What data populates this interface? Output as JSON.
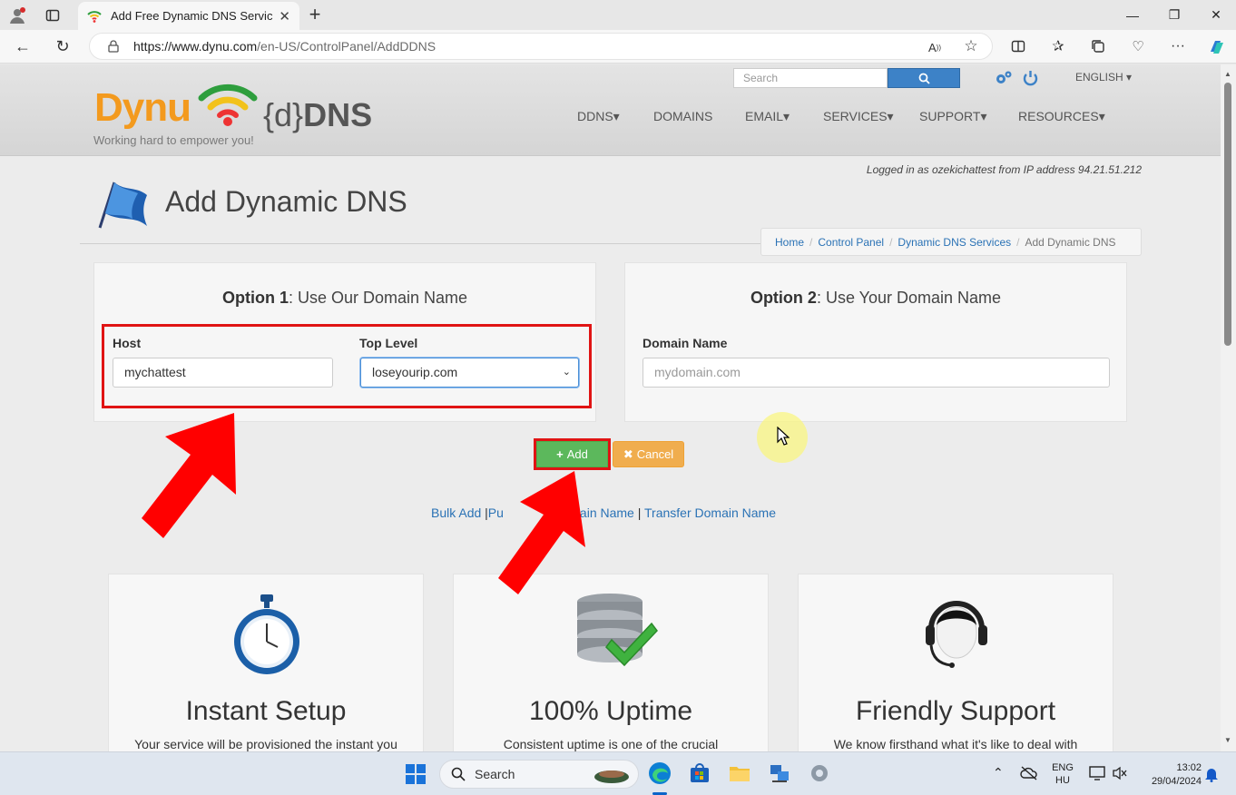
{
  "browser": {
    "tab_title": "Add Free Dynamic DNS Service |",
    "url_host": "https://www.dynu.com",
    "url_path": "/en-US/ControlPanel/AddDDNS"
  },
  "header": {
    "search_placeholder": "Search",
    "language": "ENGLISH",
    "logo_text": "Dynu",
    "logo_brace": "{d}",
    "logo_dns": "DNS",
    "tagline": "Working hard to empower you!",
    "nav": [
      "DDNS",
      "DOMAINS",
      "EMAIL",
      "SERVICES",
      "SUPPORT",
      "RESOURCES"
    ]
  },
  "page": {
    "logged_in": "Logged in as ozekichattest from IP address 94.21.51.212",
    "title": "Add Dynamic DNS",
    "breadcrumb": [
      "Home",
      "Control Panel",
      "Dynamic DNS Services",
      "Add Dynamic DNS"
    ]
  },
  "option1": {
    "title_bold": "Option 1",
    "title_rest": ": Use Our Domain Name",
    "host_label": "Host",
    "host_value": "mychattest",
    "top_level_label": "Top Level",
    "top_level_value": "loseyourip.com"
  },
  "option2": {
    "title_bold": "Option 2",
    "title_rest": ": Use Your Domain Name",
    "domain_label": "Domain Name",
    "domain_placeholder": "mydomain.com"
  },
  "actions": {
    "add": "Add",
    "cancel": "Cancel"
  },
  "links": {
    "bulk_add": "Bulk Add",
    "sep1": "|",
    "purchase_visible_start": "Pu",
    "purchase_visible_end": "ain Name",
    "sep2": "|",
    "transfer": "Transfer Domain Name"
  },
  "features": [
    {
      "title": "Instant Setup",
      "text": "Your service will be provisioned the instant you"
    },
    {
      "title": "100% Uptime",
      "text": "Consistent uptime is one of the crucial"
    },
    {
      "title": "Friendly Support",
      "text": "We know firsthand what it's like to deal with"
    }
  ],
  "taskbar": {
    "search": "Search",
    "lang_top": "ENG",
    "lang_bottom": "HU",
    "time": "13:02",
    "date": "29/04/2024"
  },
  "colors": {
    "accent_blue": "#2a72b5",
    "add_green": "#5cb85c",
    "cancel_orange": "#f0ad4e",
    "highlight_red": "#e01414",
    "logo_orange": "#f39a1e"
  }
}
